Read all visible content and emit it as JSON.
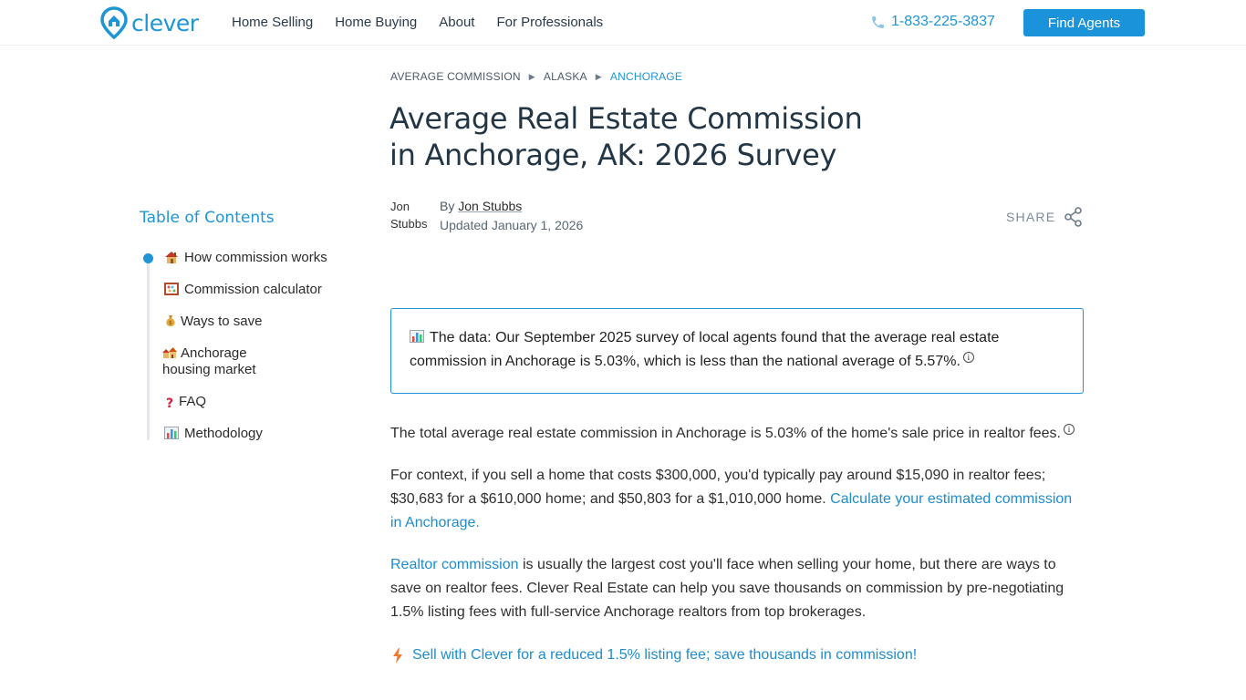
{
  "header": {
    "logo_text": "clever",
    "nav": [
      "Home Selling",
      "Home Buying",
      "About",
      "For Professionals"
    ],
    "phone": "1-833-225-3837",
    "cta_label": "Find Agents",
    "brand_color": "#1e95d4"
  },
  "toc": {
    "title": "Table of Contents",
    "items": [
      {
        "icon": "house-emoji",
        "label": "How commission works"
      },
      {
        "icon": "abacus-emoji",
        "label": "Commission calculator"
      },
      {
        "icon": "money-bag-emoji",
        "label": "Ways to save"
      },
      {
        "icon": "houses-emoji",
        "label": "Anchorage housing market"
      },
      {
        "icon": "question-mark-emoji",
        "label": "FAQ"
      },
      {
        "icon": "bar-chart-emoji",
        "label": "Methodology"
      }
    ]
  },
  "breadcrumb": [
    "AVERAGE COMMISSION",
    "ALASKA",
    "ANCHORAGE"
  ],
  "article": {
    "title_line1": "Average Real Estate Commission",
    "title_line2": "in Anchorage, AK: 2026 Survey",
    "author_img_alt": "Jon Stubbs",
    "by_prefix": "By",
    "author": "Jon Stubbs",
    "updated": "Updated January 1, 2026",
    "share_label": "SHARE",
    "data_box": {
      "prefix": "The data:",
      "text": "Our September 2025 survey of local agents found that the average real estate commission in Anchorage is 5.03%, which is less than the national average of 5.57%."
    },
    "p1": "The total average real estate commission in Anchorage is 5.03% of the home's sale price in realtor fees.",
    "p2_text": "For context, if you sell a home that costs $300,000, you'd typically pay around $15,090 in realtor fees; $30,683 for a $610,000 home; and $50,803 for a $1,010,000 home.",
    "p2_link": "Calculate your estimated commission in Anchorage.",
    "p3_link": "Realtor commission",
    "p3_text": "is usually the largest cost you'll face when selling your home, but there are ways to save on realtor fees. Clever Real Estate can help you save thousands on commission by pre-negotiating 1.5% listing fees with full-service Anchorage realtors from top brokerages.",
    "cta": "Sell with Clever for a reduced 1.5% listing fee; save thousands in commission!"
  }
}
